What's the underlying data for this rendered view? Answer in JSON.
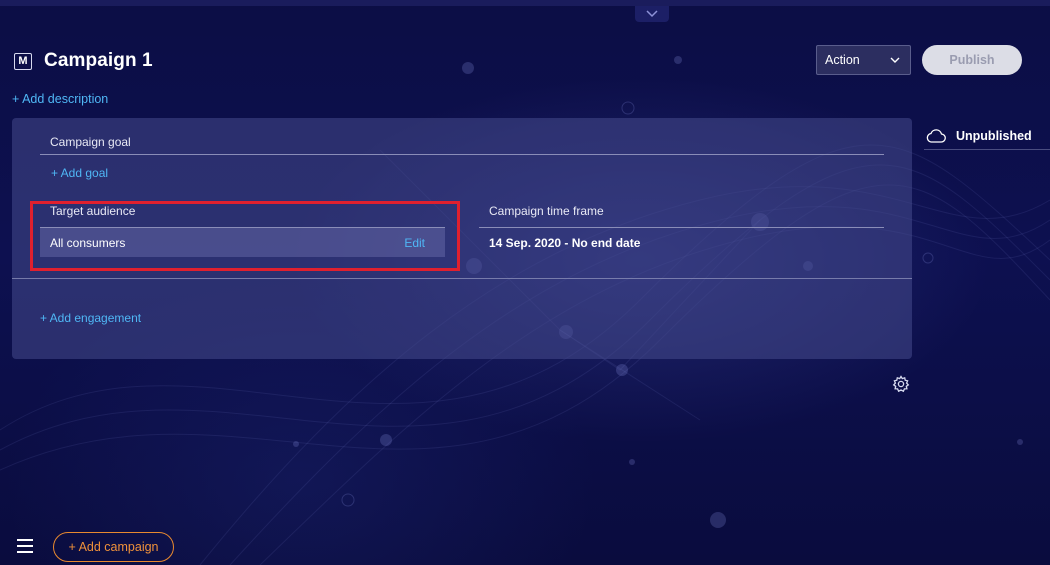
{
  "campaign": {
    "badge": "M",
    "title": "Campaign 1",
    "add_description": "+ Add description"
  },
  "toolbar": {
    "action_label": "Action",
    "publish_label": "Publish"
  },
  "status": {
    "label": "Unpublished"
  },
  "panel": {
    "goal_label": "Campaign goal",
    "add_goal": "+  Add goal",
    "target_audience": {
      "label": "Target audience",
      "value": "All consumers",
      "edit_label": "Edit"
    },
    "time_frame": {
      "label": "Campaign time frame",
      "value": "14 Sep. 2020 - No end date"
    },
    "add_engagement": "+   Add engagement"
  },
  "footer": {
    "add_campaign": "+ Add campaign"
  },
  "colors": {
    "link": "#4fb7f5",
    "highlight": "#e0202e",
    "add_campaign": "#f0913a"
  },
  "icons": [
    "chevron-down-icon",
    "cloud-icon",
    "gear-icon",
    "hamburger-menu-icon"
  ]
}
